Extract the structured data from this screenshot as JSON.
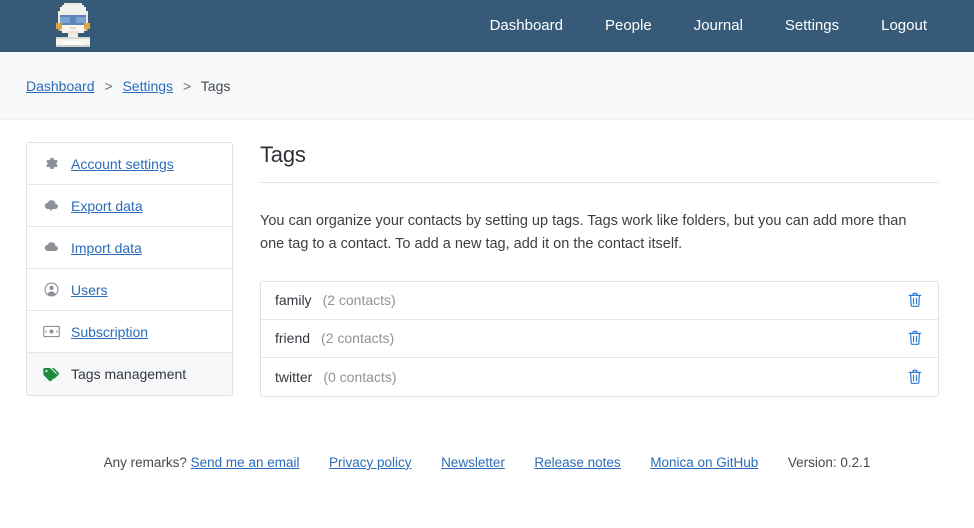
{
  "navbar": {
    "brand_icon": "monica-avatar-logo",
    "links": [
      {
        "label": "Dashboard",
        "name": "nav-dashboard"
      },
      {
        "label": "People",
        "name": "nav-people"
      },
      {
        "label": "Journal",
        "name": "nav-journal"
      },
      {
        "label": "Settings",
        "name": "nav-settings"
      },
      {
        "label": "Logout",
        "name": "nav-logout"
      }
    ],
    "background_color": "#365a78"
  },
  "breadcrumb": {
    "items": [
      {
        "label": "Dashboard",
        "link": true
      },
      {
        "label": "Settings",
        "link": true
      },
      {
        "label": "Tags",
        "link": false
      }
    ],
    "separator": ">"
  },
  "sidebar": {
    "items": [
      {
        "label": "Account settings",
        "icon": "gear-icon",
        "active": false
      },
      {
        "label": "Export data",
        "icon": "cloud-download-icon",
        "active": false
      },
      {
        "label": "Import data",
        "icon": "cloud-upload-icon",
        "active": false
      },
      {
        "label": "Users",
        "icon": "user-circle-icon",
        "active": false
      },
      {
        "label": "Subscription",
        "icon": "banknote-icon",
        "active": false
      },
      {
        "label": "Tags management",
        "icon": "tag-icon",
        "active": true
      }
    ],
    "active_tag_icon_color": "#1e8a3c"
  },
  "main": {
    "title": "Tags",
    "description": "You can organize your contacts by setting up tags. Tags work like folders, but you can add more than one tag to a contact. To add a new tag, add it on the contact itself.",
    "tags": [
      {
        "name": "family",
        "count": "(2 contacts)",
        "delete_icon": "trash-icon"
      },
      {
        "name": "friend",
        "count": "(2 contacts)",
        "delete_icon": "trash-icon"
      },
      {
        "name": "twitter",
        "count": "(0 contacts)",
        "delete_icon": "trash-icon"
      }
    ],
    "delete_icon_color": "#2b7bd4"
  },
  "footer": {
    "remark_text": "Any remarks?",
    "links": [
      {
        "label": "Send me an email"
      },
      {
        "label": "Privacy policy"
      },
      {
        "label": "Newsletter"
      },
      {
        "label": "Release notes"
      },
      {
        "label": "Monica on GitHub"
      }
    ],
    "version": "Version: 0.2.1"
  }
}
